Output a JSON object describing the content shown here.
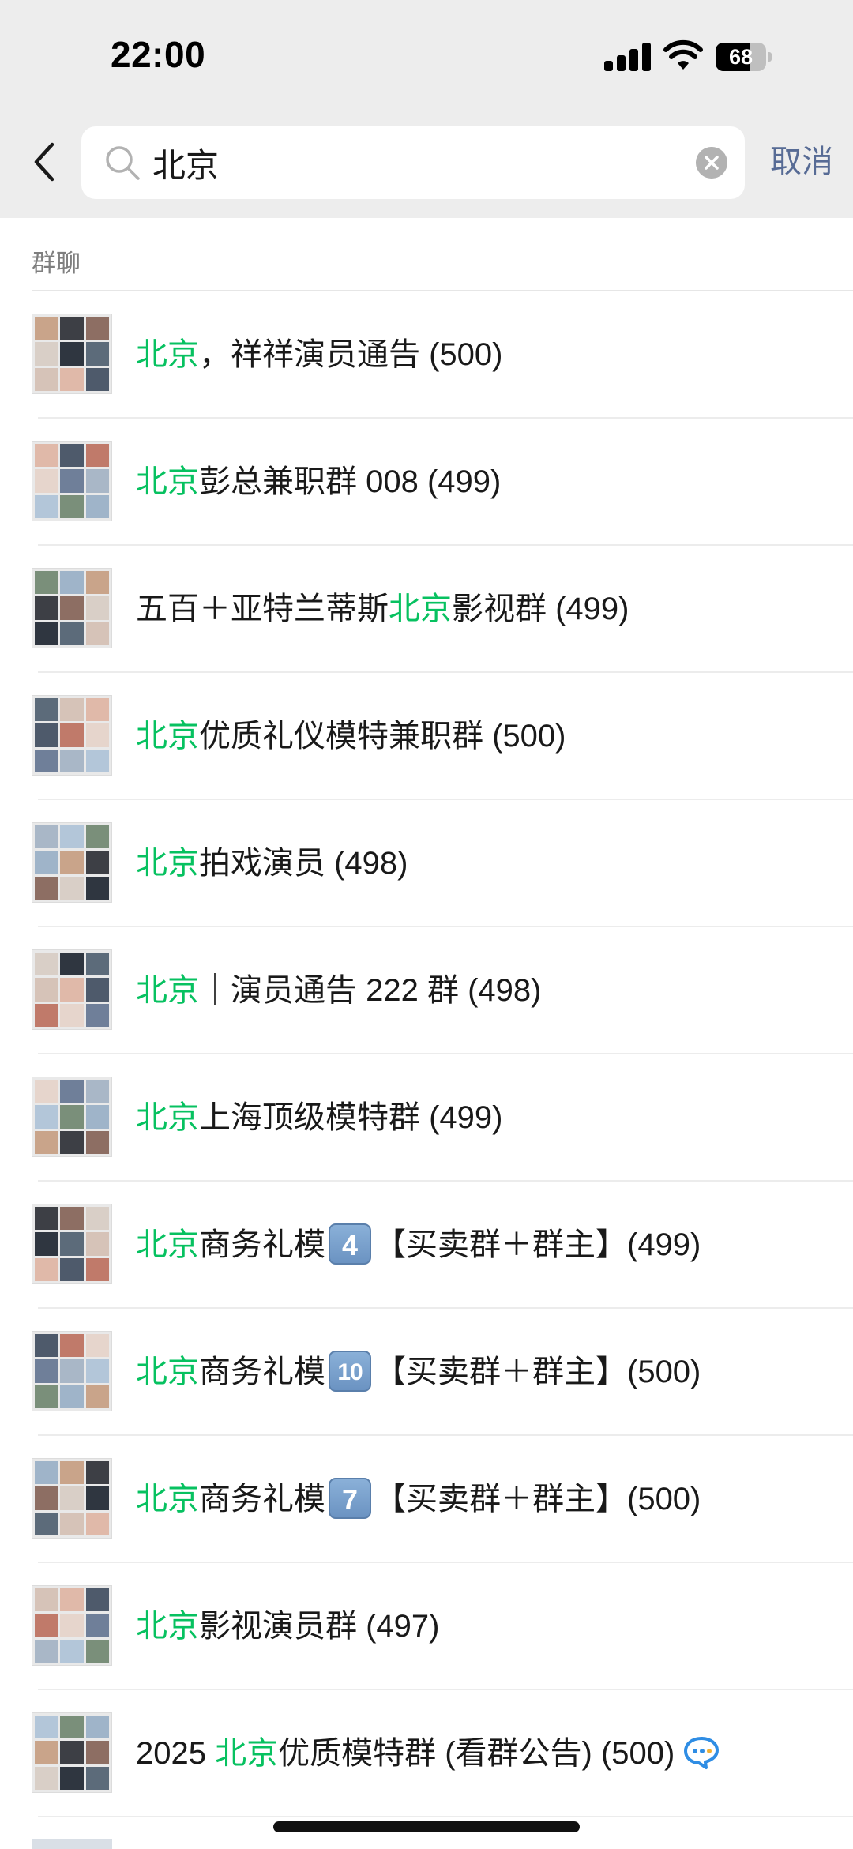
{
  "status_bar": {
    "time": "22:00",
    "battery": "68",
    "battery_level": 0.68
  },
  "search": {
    "query": "北京",
    "cancel_label": "取消"
  },
  "section": {
    "header": "群聊"
  },
  "results": [
    {
      "segments": [
        {
          "text": "北京",
          "hl": true
        },
        {
          "text": "，祥祥演员通告 (500)",
          "hl": false
        }
      ]
    },
    {
      "segments": [
        {
          "text": "北京",
          "hl": true
        },
        {
          "text": "彭总兼职群 008 (499)",
          "hl": false
        }
      ]
    },
    {
      "segments": [
        {
          "text": "五百＋亚特兰蒂斯",
          "hl": false
        },
        {
          "text": "北京",
          "hl": true
        },
        {
          "text": "影视群 (499)",
          "hl": false
        }
      ]
    },
    {
      "segments": [
        {
          "text": "北京",
          "hl": true
        },
        {
          "text": "优质礼仪模特兼职群 (500)",
          "hl": false
        }
      ]
    },
    {
      "segments": [
        {
          "text": "北京",
          "hl": true
        },
        {
          "text": "拍戏演员 (498)",
          "hl": false
        }
      ]
    },
    {
      "segments": [
        {
          "text": "北京",
          "hl": true
        },
        {
          "text": "｜演员通告 222 群 (498)",
          "hl": false
        }
      ]
    },
    {
      "segments": [
        {
          "text": "北京",
          "hl": true
        },
        {
          "text": "上海顶级模特群 (499)",
          "hl": false
        }
      ]
    },
    {
      "segments": [
        {
          "text": "北京",
          "hl": true
        },
        {
          "text": "商务礼模",
          "hl": false
        },
        {
          "keycap": "4"
        },
        {
          "text": "【买卖群＋群主】(499)",
          "hl": false
        }
      ]
    },
    {
      "segments": [
        {
          "text": "北京",
          "hl": true
        },
        {
          "text": "商务礼模",
          "hl": false
        },
        {
          "keycap": "10"
        },
        {
          "text": "【买卖群＋群主】(500)",
          "hl": false
        }
      ]
    },
    {
      "segments": [
        {
          "text": "北京",
          "hl": true
        },
        {
          "text": "商务礼模",
          "hl": false
        },
        {
          "keycap": "7"
        },
        {
          "text": "【买卖群＋群主】(500)",
          "hl": false
        }
      ]
    },
    {
      "segments": [
        {
          "text": "北京",
          "hl": true
        },
        {
          "text": "影视演员群 (497)",
          "hl": false
        }
      ]
    },
    {
      "segments": [
        {
          "text": "2025 ",
          "hl": false
        },
        {
          "text": "北京",
          "hl": true
        },
        {
          "text": "优质模特群 (看群公告) (500)",
          "hl": false
        },
        {
          "icon": "chat-bubble-icon"
        }
      ]
    }
  ],
  "colors": {
    "highlight": "#07c160",
    "cancel": "#576b95",
    "header_bg": "#ededed"
  }
}
